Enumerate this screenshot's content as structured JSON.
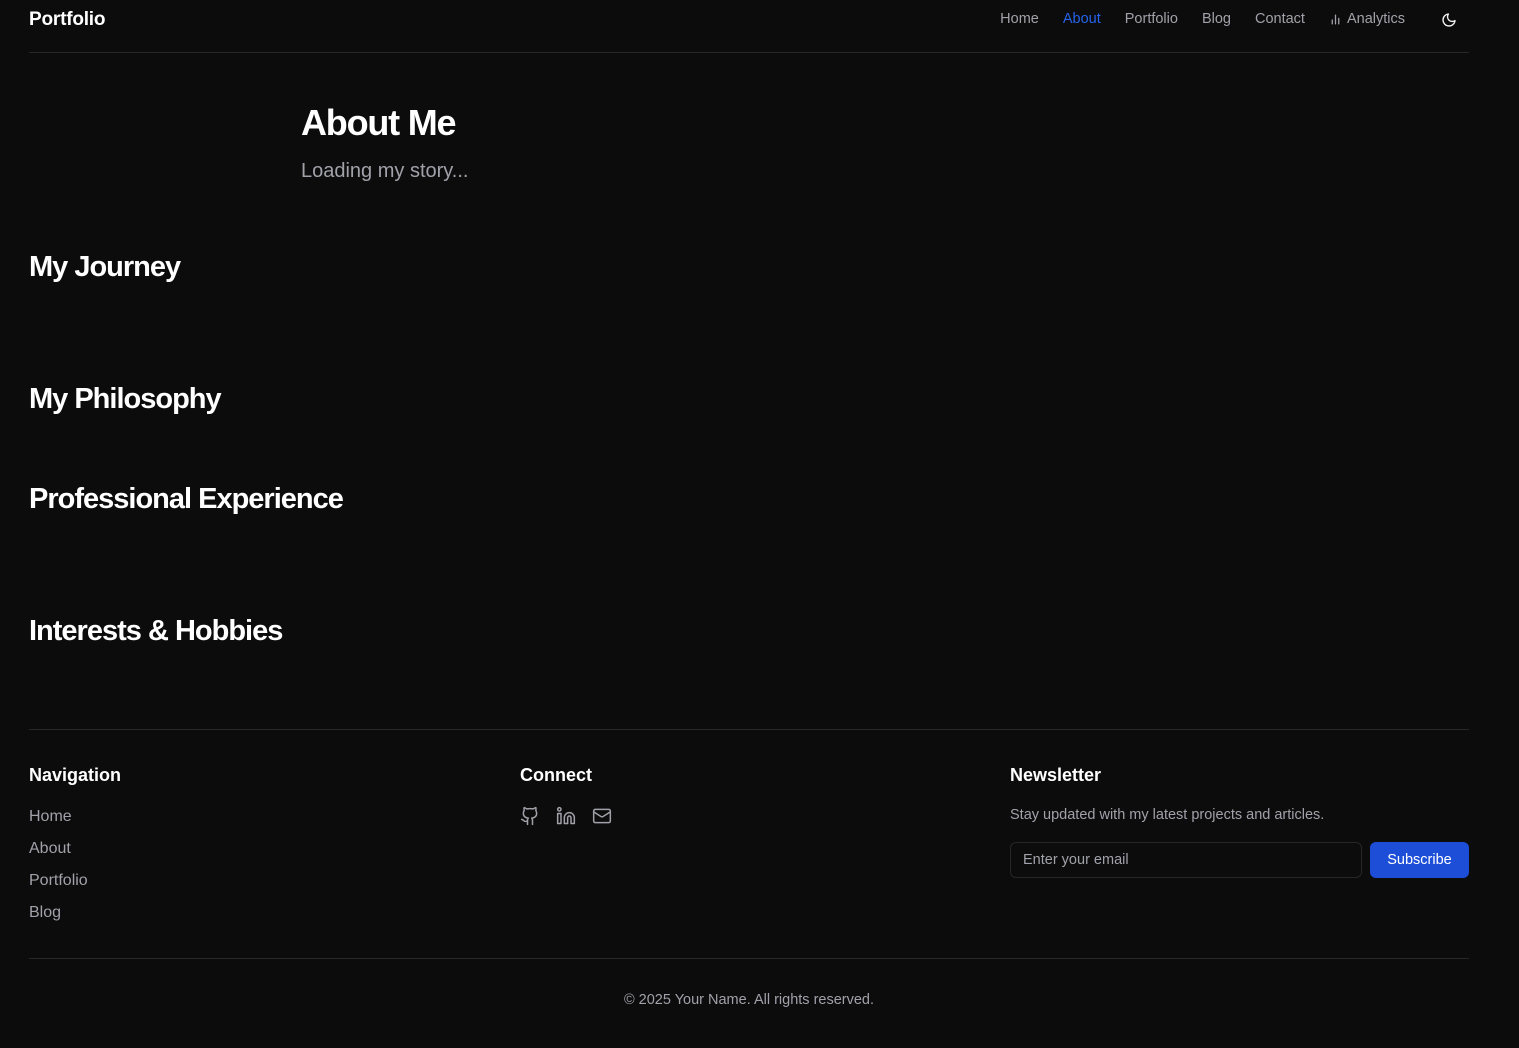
{
  "header": {
    "brand": "Portfolio",
    "nav": [
      {
        "label": "Home",
        "active": false
      },
      {
        "label": "About",
        "active": true
      },
      {
        "label": "Portfolio",
        "active": false
      },
      {
        "label": "Blog",
        "active": false
      },
      {
        "label": "Contact",
        "active": false
      },
      {
        "label": "Analytics",
        "active": false,
        "icon": "bar-chart-icon"
      }
    ],
    "theme_toggle_icon": "moon-icon"
  },
  "hero": {
    "title": "About Me",
    "subtitle": "Loading my story..."
  },
  "sections": [
    "My Journey",
    "My Philosophy",
    "Professional Experience",
    "Interests & Hobbies"
  ],
  "footer": {
    "navigation": {
      "title": "Navigation",
      "links": [
        "Home",
        "About",
        "Portfolio",
        "Blog"
      ]
    },
    "connect": {
      "title": "Connect",
      "icons": [
        "github-icon",
        "linkedin-icon",
        "mail-icon"
      ]
    },
    "newsletter": {
      "title": "Newsletter",
      "text": "Stay updated with my latest projects and articles.",
      "placeholder": "Enter your email",
      "button": "Subscribe"
    },
    "copyright": "© 2025 Your Name. All rights reserved."
  },
  "colors": {
    "background": "#0c0c0c",
    "accent": "#2563eb",
    "button": "#1d4ed8",
    "muted_text": "#a1a1aa",
    "border": "#27272a"
  }
}
